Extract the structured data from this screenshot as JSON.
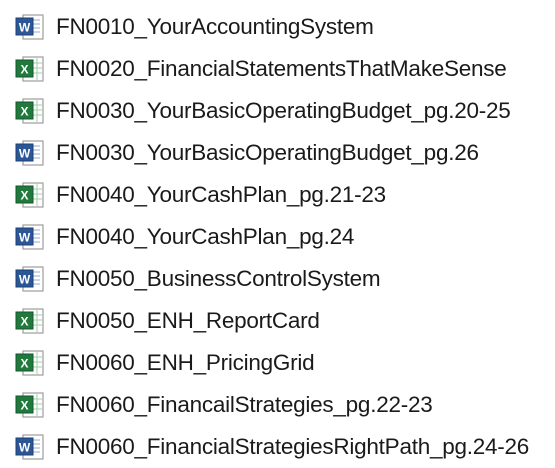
{
  "files": [
    {
      "name": "FN0010_YourAccountingSystem",
      "icon": "word-doc-icon"
    },
    {
      "name": "FN0020_FinancialStatementsThatMakeSense",
      "icon": "excel-sheet-icon"
    },
    {
      "name": "FN0030_YourBasicOperatingBudget_pg.20-25",
      "icon": "excel-sheet-icon"
    },
    {
      "name": "FN0030_YourBasicOperatingBudget_pg.26",
      "icon": "word-doc-icon"
    },
    {
      "name": "FN0040_YourCashPlan_pg.21-23",
      "icon": "excel-sheet-icon"
    },
    {
      "name": "FN0040_YourCashPlan_pg.24",
      "icon": "word-doc-icon"
    },
    {
      "name": "FN0050_BusinessControlSystem",
      "icon": "word-doc-icon"
    },
    {
      "name": "FN0050_ENH_ReportCard",
      "icon": "excel-sheet-icon"
    },
    {
      "name": "FN0060_ENH_PricingGrid",
      "icon": "excel-sheet-icon"
    },
    {
      "name": "FN0060_FinancailStrategies_pg.22-23",
      "icon": "excel-sheet-icon"
    },
    {
      "name": "FN0060_FinancialStrategiesRightPath_pg.24-26",
      "icon": "word-doc-icon"
    }
  ],
  "colors": {
    "word_blue": "#2b5797",
    "excel_green": "#1f7a3c",
    "text": "#1a1a1a"
  }
}
